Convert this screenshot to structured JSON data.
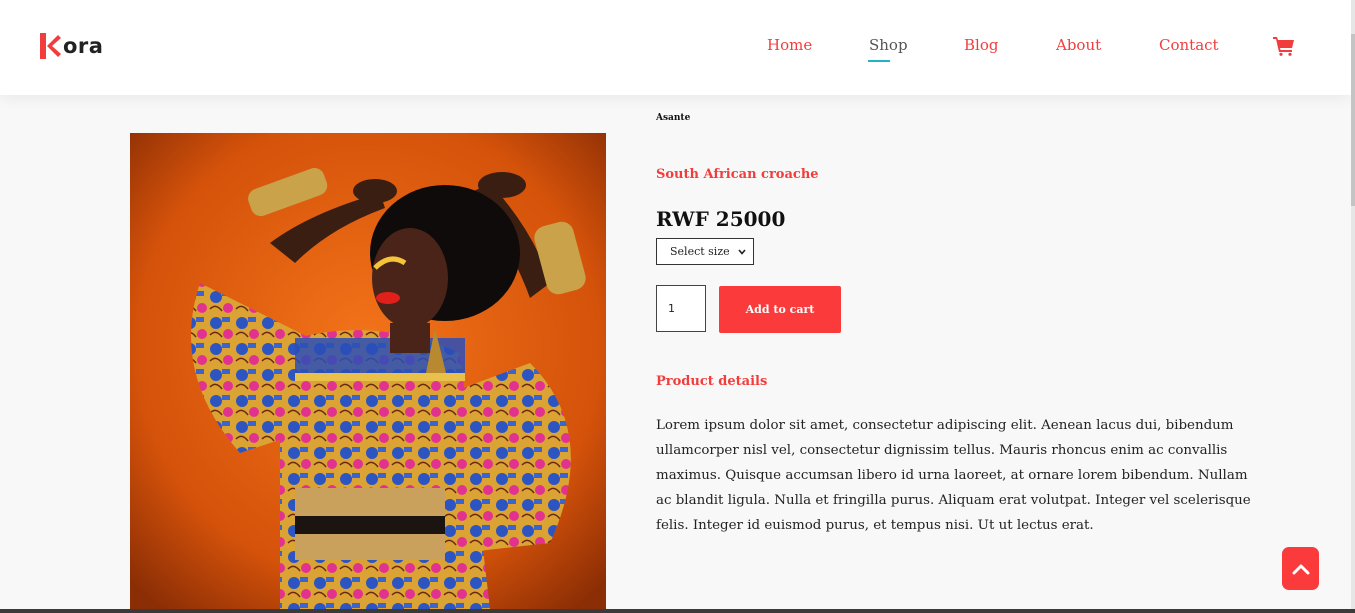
{
  "brand": {
    "logo_text": "ora",
    "logo_color": "#f23d3d"
  },
  "nav": {
    "items": [
      {
        "label": "Home",
        "active": false
      },
      {
        "label": "Shop",
        "active": true
      },
      {
        "label": "Blog",
        "active": false
      },
      {
        "label": "About",
        "active": false
      },
      {
        "label": "Contact",
        "active": false
      }
    ],
    "cart_icon": "shopping-cart-icon"
  },
  "product": {
    "brand": "Asante",
    "name": "South African croache",
    "price": "RWF 25000",
    "size_select": {
      "selected": "Select size"
    },
    "quantity": "1",
    "add_to_cart_label": "Add to cart",
    "details_title": "Product details",
    "description": "Lorem ipsum dolor sit amet, consectetur adipiscing elit. Aenean lacus dui, bibendum ullamcorper nisl vel, consectetur dignissim tellus. Mauris rhoncus enim ac convallis maximus. Quisque accumsan libero id urna laoreet, at ornare lorem bibendum. Nullam ac blandit ligula. Nulla et fringilla purus. Aliquam erat volutpat. Integer vel scelerisque felis. Integer id euismod purus, et tempus nisi. Ut ut lectus erat.",
    "image_icon": "product-photo"
  },
  "scroll_top_icon": "chevron-up-icon",
  "colors": {
    "accent": "#f23d3d",
    "button": "#fb3a3c",
    "active_underline": "#21b4c4"
  }
}
